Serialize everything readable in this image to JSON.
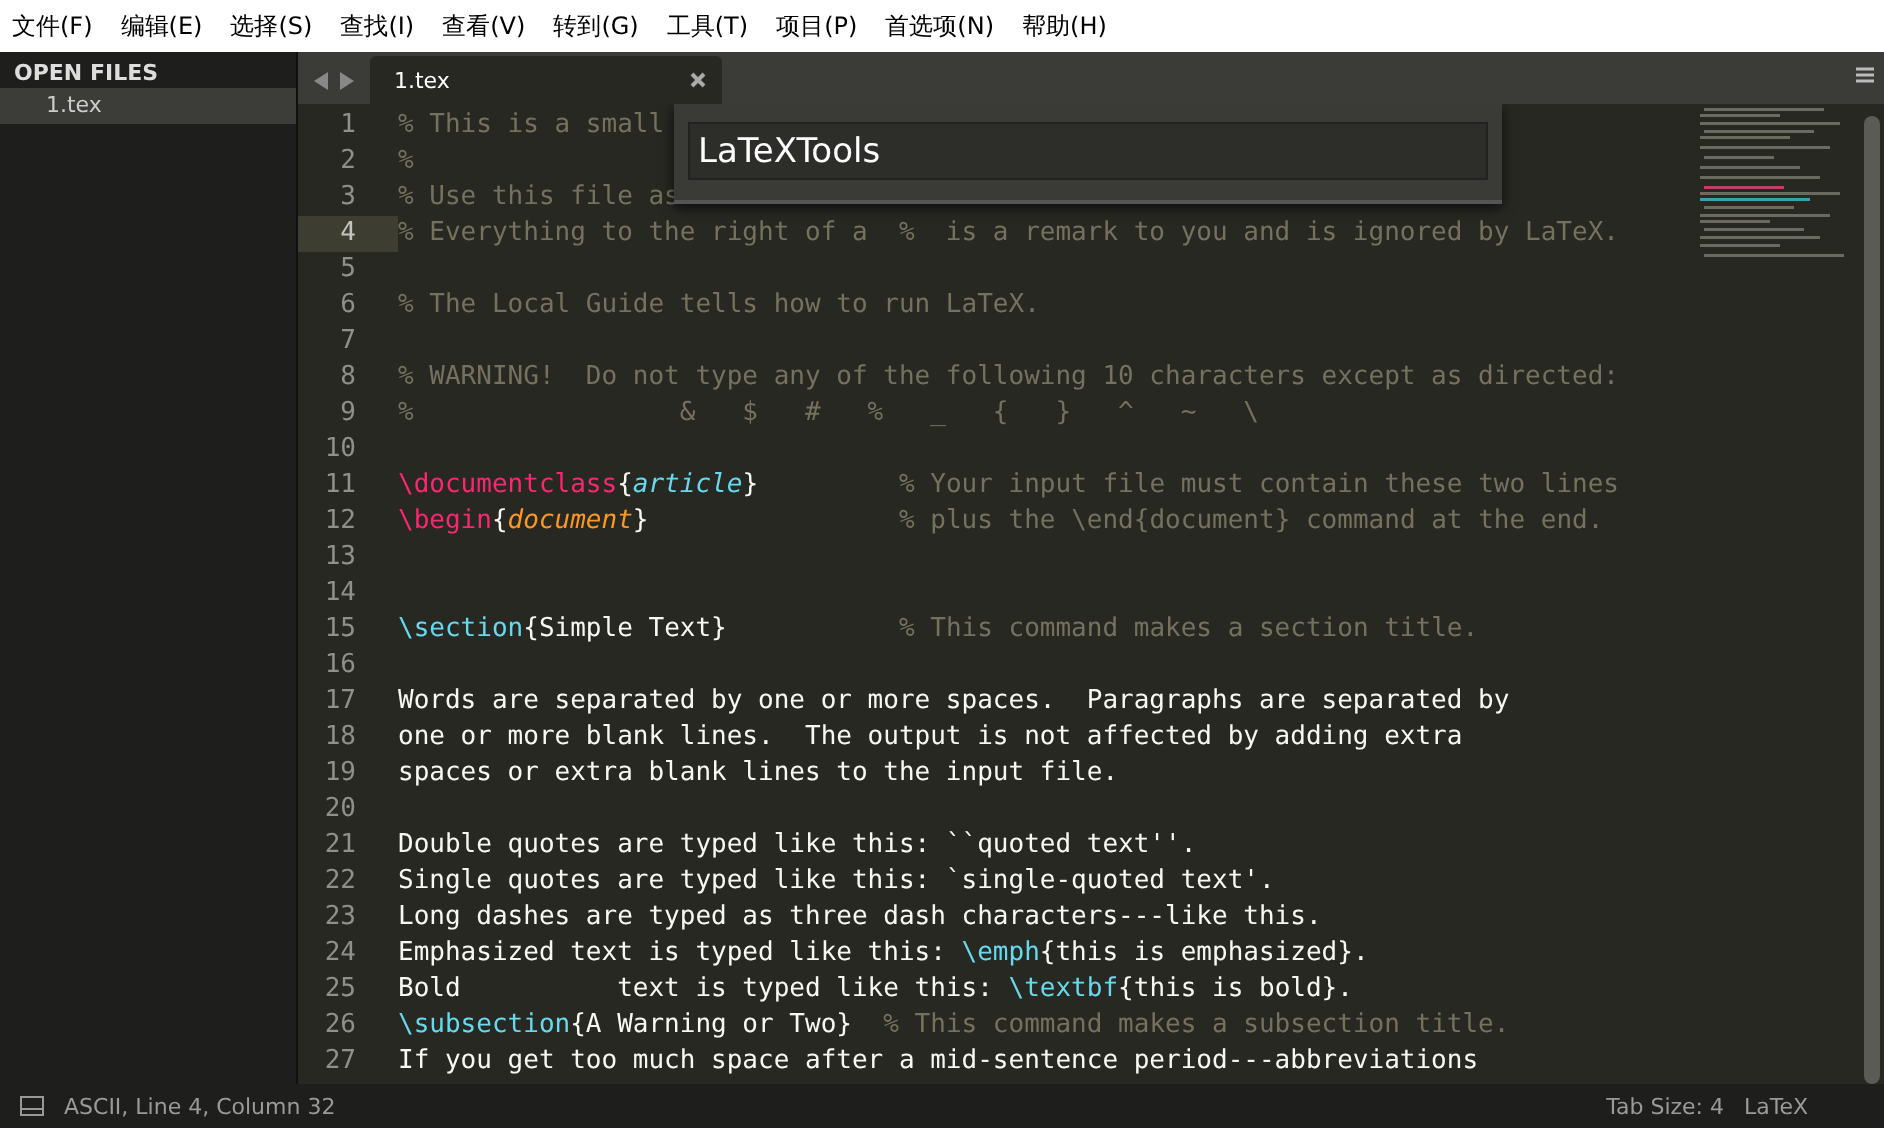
{
  "menu": [
    "文件(F)",
    "编辑(E)",
    "选择(S)",
    "查找(I)",
    "查看(V)",
    "转到(G)",
    "工具(T)",
    "项目(P)",
    "首选项(N)",
    "帮助(H)"
  ],
  "sidebar": {
    "header": "OPEN FILES",
    "files": [
      {
        "name": "1.tex",
        "selected": true
      }
    ]
  },
  "tabs": [
    {
      "label": "1.tex",
      "selected": true
    }
  ],
  "editor": {
    "lines": [
      {
        "number": "1",
        "current": false,
        "tokens": [
          {
            "kind": "comment",
            "text": "% This is a small"
          }
        ]
      },
      {
        "number": "2",
        "current": false,
        "tokens": [
          {
            "kind": "comment",
            "text": "%"
          }
        ]
      },
      {
        "number": "3",
        "current": false,
        "tokens": [
          {
            "kind": "comment",
            "text": "% Use this file as"
          }
        ]
      },
      {
        "number": "4",
        "current": true,
        "tokens": [
          {
            "kind": "comment",
            "text": "% Everything to the right of a  %  is a remark to you and is ignored by LaTeX."
          }
        ]
      },
      {
        "number": "5",
        "current": false
      },
      {
        "number": "6",
        "current": false,
        "tokens": [
          {
            "kind": "comment",
            "text": "% The Local Guide tells how to run LaTeX."
          }
        ]
      },
      {
        "number": "7",
        "current": false
      },
      {
        "number": "8",
        "current": false,
        "tokens": [
          {
            "kind": "comment",
            "text": "% WARNING!  Do not type any of the following 10 characters except as directed:"
          }
        ]
      },
      {
        "number": "9",
        "current": false,
        "tokens": [
          {
            "kind": "comment",
            "text": "%                 &   $   #   %   _   {   }   ^   ~   \\"
          }
        ]
      },
      {
        "number": "10",
        "current": false
      },
      {
        "number": "11",
        "current": false,
        "tokens": [
          {
            "kind": "keyword",
            "text": "\\documentclass"
          },
          {
            "kind": "text",
            "text": "{"
          },
          {
            "kind": "arg",
            "text": "article"
          },
          {
            "kind": "text",
            "text": "}         "
          },
          {
            "kind": "comment",
            "text": "% Your input file must contain these two lines"
          }
        ]
      },
      {
        "number": "12",
        "current": false,
        "tokens": [
          {
            "kind": "keyword",
            "text": "\\begin"
          },
          {
            "kind": "text",
            "text": "{"
          },
          {
            "kind": "env",
            "text": "document"
          },
          {
            "kind": "text",
            "text": "}                "
          },
          {
            "kind": "comment",
            "text": "% plus the \\end{document} command at the end."
          }
        ]
      },
      {
        "number": "13",
        "current": false
      },
      {
        "number": "14",
        "current": false
      },
      {
        "number": "15",
        "current": false,
        "tokens": [
          {
            "kind": "command",
            "text": "\\section"
          },
          {
            "kind": "text",
            "text": "{Simple Text}           "
          },
          {
            "kind": "comment",
            "text": "% This command makes a section title."
          }
        ]
      },
      {
        "number": "16",
        "current": false
      },
      {
        "number": "17",
        "current": false,
        "tokens": [
          {
            "kind": "text",
            "text": "Words are separated by one or more spaces.  Paragraphs are separated by"
          }
        ]
      },
      {
        "number": "18",
        "current": false,
        "tokens": [
          {
            "kind": "text",
            "text": "one or more blank lines.  The output is not affected by adding extra"
          }
        ]
      },
      {
        "number": "19",
        "current": false,
        "tokens": [
          {
            "kind": "text",
            "text": "spaces or extra blank lines to the input file."
          }
        ]
      },
      {
        "number": "20",
        "current": false
      },
      {
        "number": "21",
        "current": false,
        "tokens": [
          {
            "kind": "text",
            "text": "Double quotes are typed like this: ``quoted text''."
          }
        ]
      },
      {
        "number": "22",
        "current": false,
        "tokens": [
          {
            "kind": "text",
            "text": "Single quotes are typed like this: `single-quoted text'."
          }
        ]
      },
      {
        "number": "23",
        "current": false,
        "tokens": [
          {
            "kind": "text",
            "text": "Long dashes are typed as three dash characters---like this."
          }
        ]
      },
      {
        "number": "24",
        "current": false,
        "tokens": [
          {
            "kind": "text",
            "text": "Emphasized text is typed like this: "
          },
          {
            "kind": "command",
            "text": "\\emph"
          },
          {
            "kind": "text",
            "text": "{this is emphasized}."
          }
        ]
      },
      {
        "number": "25",
        "current": false,
        "tokens": [
          {
            "kind": "text",
            "text": "Bold          text is typed like this: "
          },
          {
            "kind": "command",
            "text": "\\textbf"
          },
          {
            "kind": "text",
            "text": "{this is bold}."
          }
        ]
      },
      {
        "number": "26",
        "current": false,
        "tokens": [
          {
            "kind": "command",
            "text": "\\subsection"
          },
          {
            "kind": "text",
            "text": "{A Warning or Two}  "
          },
          {
            "kind": "comment",
            "text": "% This command makes a subsection title."
          }
        ]
      },
      {
        "number": "27",
        "current": false,
        "tokens": [
          {
            "kind": "text",
            "text": "If you get too much space after a mid-sentence period---abbreviations"
          }
        ]
      }
    ]
  },
  "popup": {
    "value": "LaTeXTools"
  },
  "status_bar": {
    "position": "ASCII, Line 4, Column 32",
    "tab_size": "Tab Size: 4",
    "syntax": "LaTeX"
  }
}
